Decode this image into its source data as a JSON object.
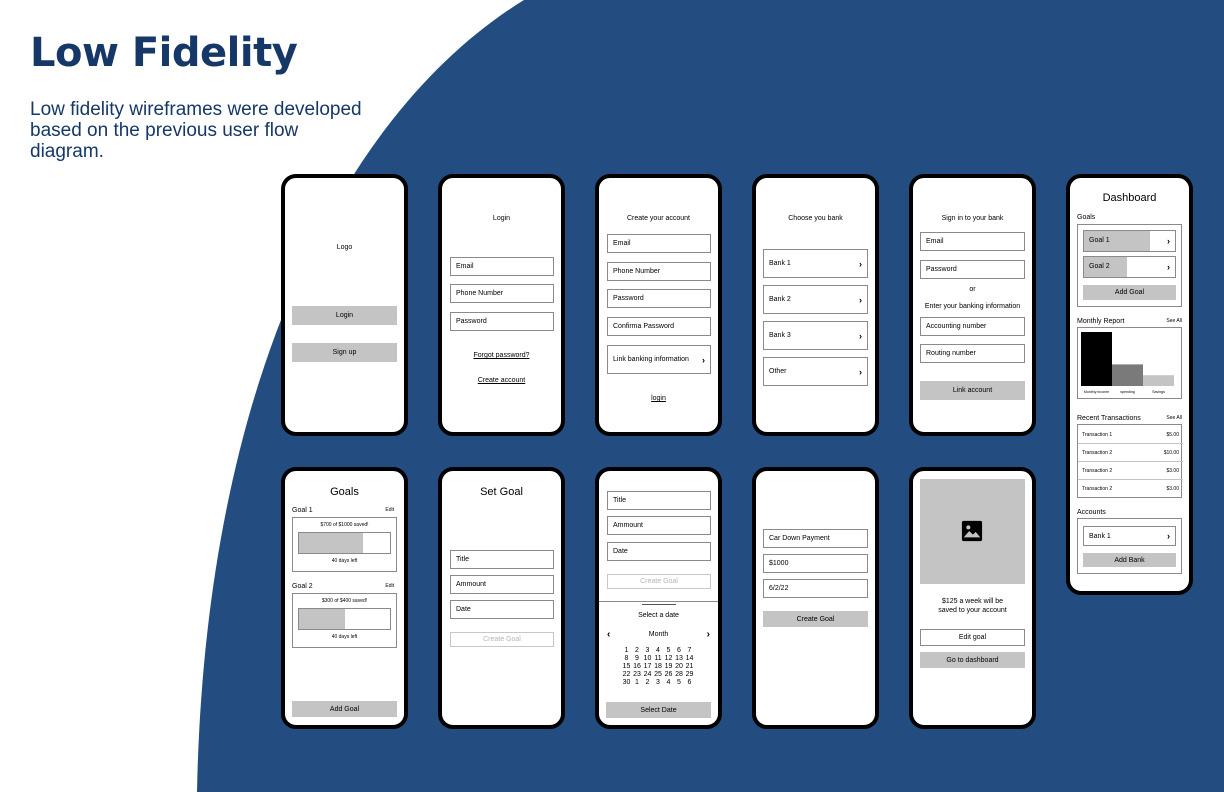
{
  "page": {
    "title": "Low Fidelity",
    "subtitle": "Low fidelity wireframes were developed based on the previous user flow diagram.",
    "colors": {
      "title": "#163868",
      "background_shape": "#234d80",
      "phone_frame": "#000000",
      "placeholder_gray": "#c4c4c4"
    }
  },
  "splash": {
    "logo": "Logo",
    "login": "Login",
    "signup": "Sign up"
  },
  "login": {
    "heading": "Login",
    "email": "Email",
    "phone": "Phone Number",
    "password": "Password",
    "forgot": "Forgot password?",
    "create": "Create account"
  },
  "create_account": {
    "heading": "Create your account",
    "email": "Email",
    "phone": "Phone Number",
    "password": "Password",
    "confirm": "Confirma Password",
    "link_banking": "Link banking information",
    "login": "login"
  },
  "choose_bank": {
    "heading": "Choose you bank",
    "banks": [
      "Bank 1",
      "Bank 2",
      "Bank 3",
      "Other"
    ]
  },
  "bank_signin": {
    "heading": "Sign in to your bank",
    "email": "Email",
    "password": "Password",
    "or": "or",
    "enter_info": "Enter your banking information",
    "accounting": "Accounting number",
    "routing": "Routing number",
    "link": "Link account"
  },
  "dashboard": {
    "heading": "Dashboard",
    "goals_label": "Goals",
    "goals": [
      {
        "name": "Goal 1",
        "progress": 0.73
      },
      {
        "name": "Goal 2",
        "progress": 0.47
      }
    ],
    "add_goal": "Add Goal",
    "monthly_report": "Monthly Report",
    "see_all": "See All",
    "chart": {
      "categories": [
        "Monthly income",
        "spending",
        "Savings"
      ],
      "values": [
        1.0,
        0.4,
        0.2
      ],
      "colors": [
        "#000000",
        "#7a7a7a",
        "#c4c4c4"
      ]
    },
    "recent_transactions": "Recent Transactions",
    "transactions": [
      {
        "name": "Transaction 1",
        "amount": "$5.00"
      },
      {
        "name": "Transaction 2",
        "amount": "$10.00"
      },
      {
        "name": "Transaction 2",
        "amount": "$3.00"
      },
      {
        "name": "Transaction 2",
        "amount": "$3.00"
      }
    ],
    "accounts_label": "Accounts",
    "bank": "Bank 1",
    "add_bank": "Add Bank"
  },
  "goals_screen": {
    "heading": "Goals",
    "edit": "Edit",
    "goals": [
      {
        "name": "Goal 1",
        "saved": "$700 of $1000 saved!",
        "days": "40 days left",
        "progress": 0.7
      },
      {
        "name": "Goal 2",
        "saved": "$300 of $400 saved!",
        "days": "40 days left",
        "progress": 0.5
      }
    ],
    "add_goal": "Add Goal"
  },
  "set_goal": {
    "heading": "Set Goal",
    "title": "Title",
    "amount": "Ammount",
    "date": "Date",
    "create": "Create Goal"
  },
  "date_picker": {
    "title": "Title",
    "amount": "Ammount",
    "date": "Date",
    "create": "Create Goal",
    "select_label": "Select a date",
    "month": "Month",
    "prev": "‹",
    "next": "›",
    "weeks": [
      [
        "1",
        "2",
        "3",
        "4",
        "5",
        "6",
        "7"
      ],
      [
        "8",
        "9",
        "10",
        "11",
        "12",
        "13",
        "14"
      ],
      [
        "15",
        "16",
        "17",
        "18",
        "19",
        "20",
        "21"
      ],
      [
        "22",
        "23",
        "24",
        "25",
        "26",
        "28",
        "29"
      ],
      [
        "30",
        "1",
        "2",
        "3",
        "4",
        "5",
        "6"
      ]
    ],
    "select_button": "Select Date"
  },
  "filled_goal": {
    "title": "Car Down Payment",
    "amount": "$1000",
    "date": "6/2/22",
    "create": "Create Goal"
  },
  "confirmation": {
    "message_line1": "$125 a week will be",
    "message_line2": "saved to your account",
    "edit": "Edit goal",
    "dashboard": "Go to dashboard"
  }
}
